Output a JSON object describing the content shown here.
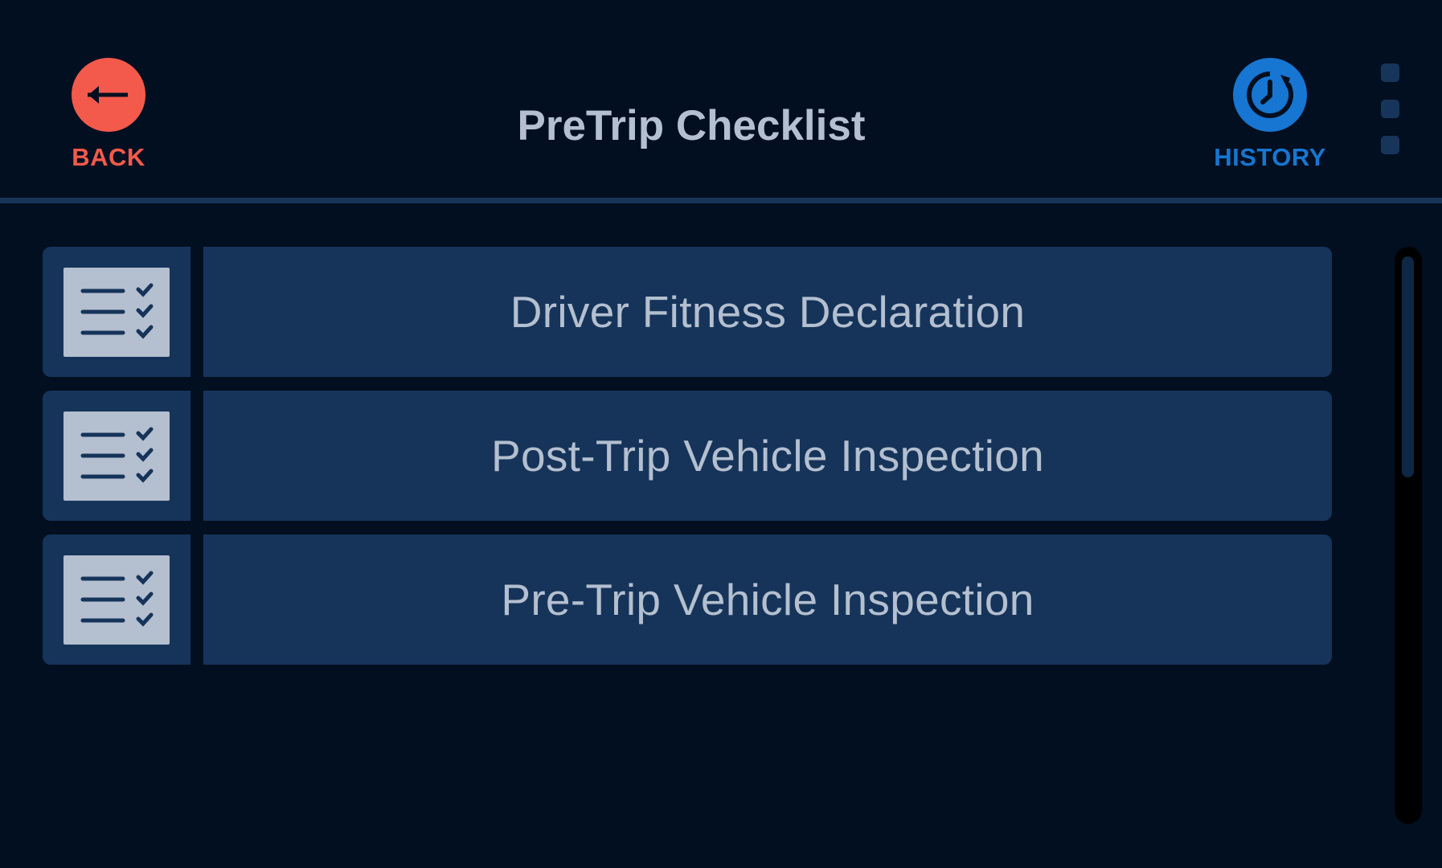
{
  "header": {
    "title": "PreTrip Checklist",
    "back_label": "BACK",
    "history_label": "HISTORY"
  },
  "icons": {
    "back": "arrow-left-icon",
    "history": "clock-history-icon",
    "overflow": "overflow-menu-icon",
    "checklist": "checklist-icon"
  },
  "colors": {
    "background": "#020f20",
    "card": "#16345a",
    "text": "#b4bfcf",
    "back_accent": "#f35a4b",
    "history_accent": "#1676d2"
  },
  "checklists": [
    {
      "label": "Driver Fitness Declaration"
    },
    {
      "label": "Post-Trip Vehicle Inspection"
    },
    {
      "label": "Pre-Trip Vehicle Inspection"
    }
  ]
}
